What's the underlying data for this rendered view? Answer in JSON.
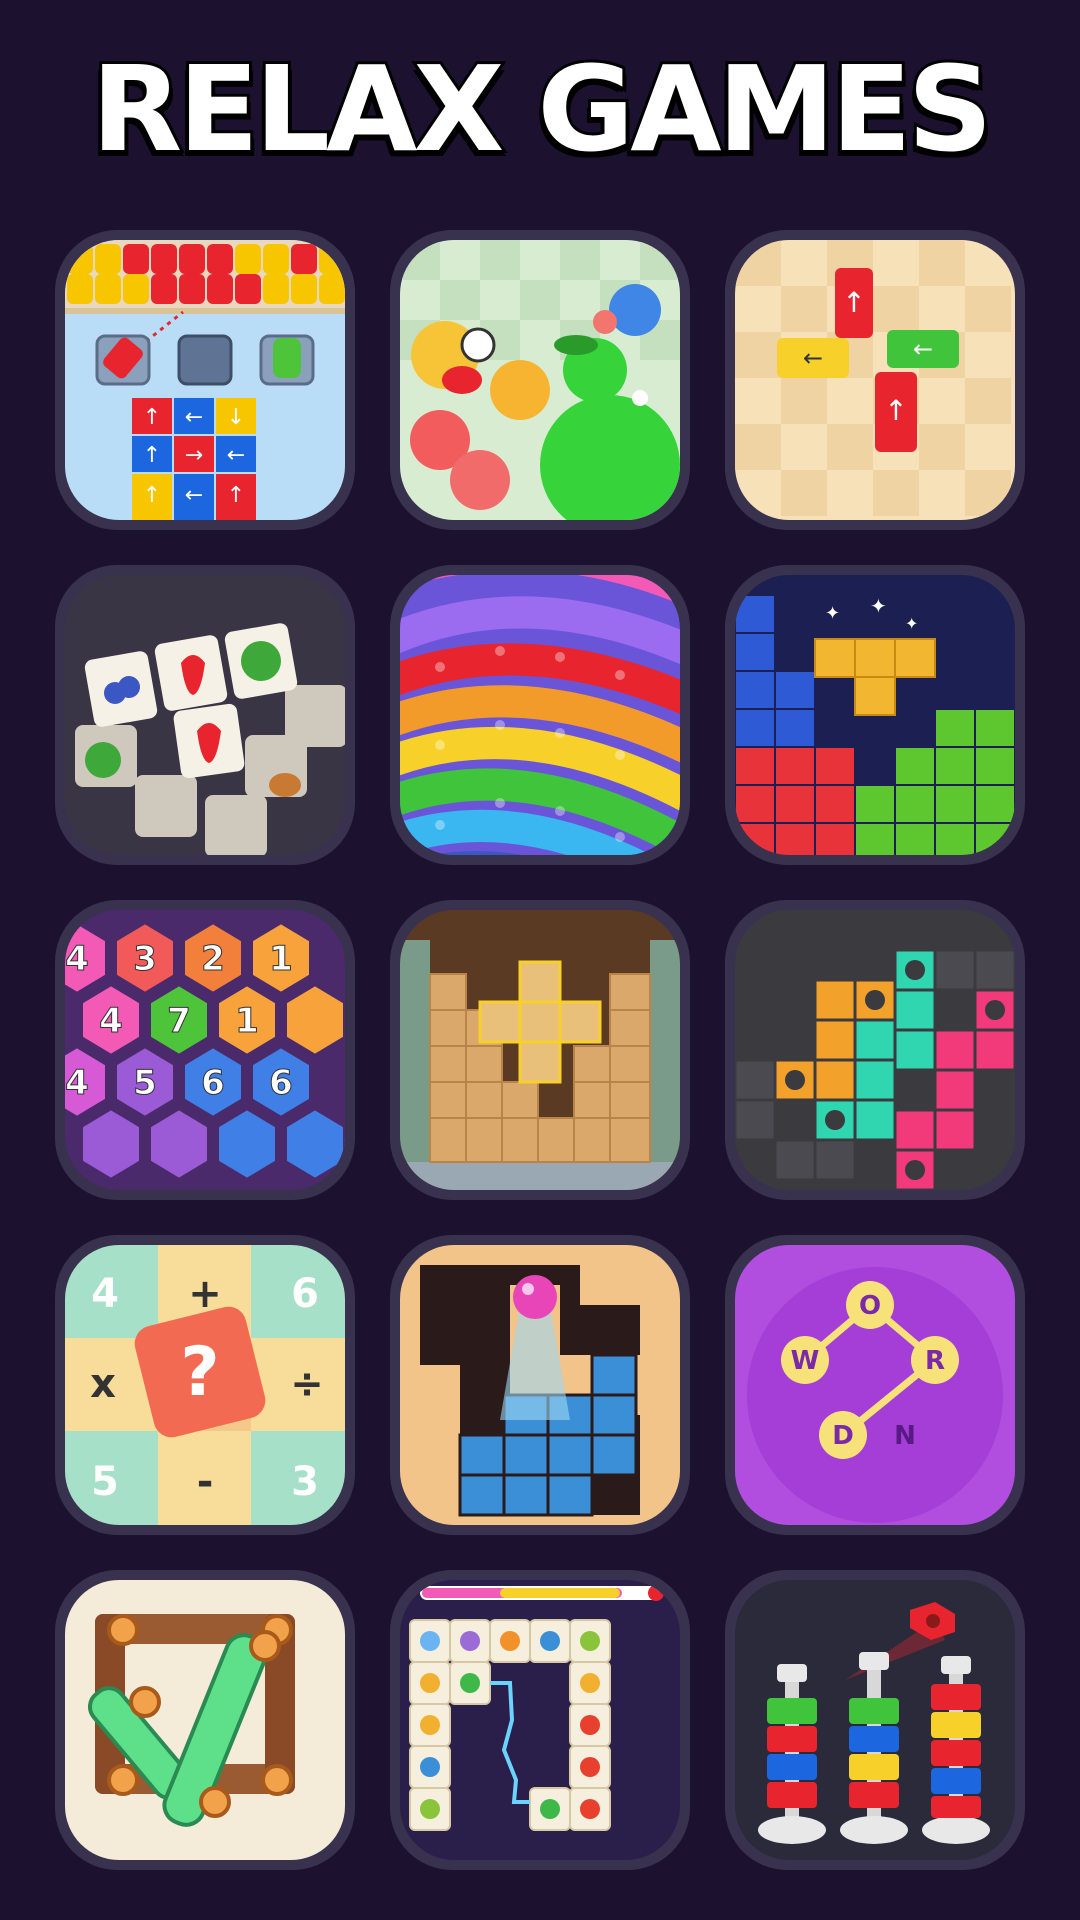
{
  "title": "RELAX GAMES",
  "colors": {
    "background": "#1c1230",
    "tile_frame": "#39324f",
    "title_text": "#ffffff"
  },
  "games": [
    {
      "icon": "cannon-color-block-icon"
    },
    {
      "icon": "animal-merge-icon"
    },
    {
      "icon": "bus-traffic-escape-icon"
    },
    {
      "icon": "fruit-tile-match-icon"
    },
    {
      "icon": "rainbow-block-jam-icon"
    },
    {
      "icon": "block-puzzle-icon"
    },
    {
      "icon": "hexagon-number-merge-icon",
      "numbers": [
        "4",
        "3",
        "2",
        "1",
        "4",
        "7",
        "1",
        "4",
        "5",
        "6",
        "6"
      ]
    },
    {
      "icon": "wood-block-puzzle-icon"
    },
    {
      "icon": "pipe-connect-icon"
    },
    {
      "icon": "math-puzzle-icon",
      "symbols": [
        "4",
        "+",
        "6",
        "x",
        "?",
        "÷",
        "5",
        "-",
        "3"
      ]
    },
    {
      "icon": "ball-drop-maze-icon"
    },
    {
      "icon": "word-connect-icon",
      "letters": [
        "W",
        "O",
        "R",
        "D",
        "N"
      ]
    },
    {
      "icon": "wood-screw-puzzle-icon"
    },
    {
      "icon": "animal-tile-connect-icon"
    },
    {
      "icon": "nuts-bolts-sort-icon"
    }
  ]
}
